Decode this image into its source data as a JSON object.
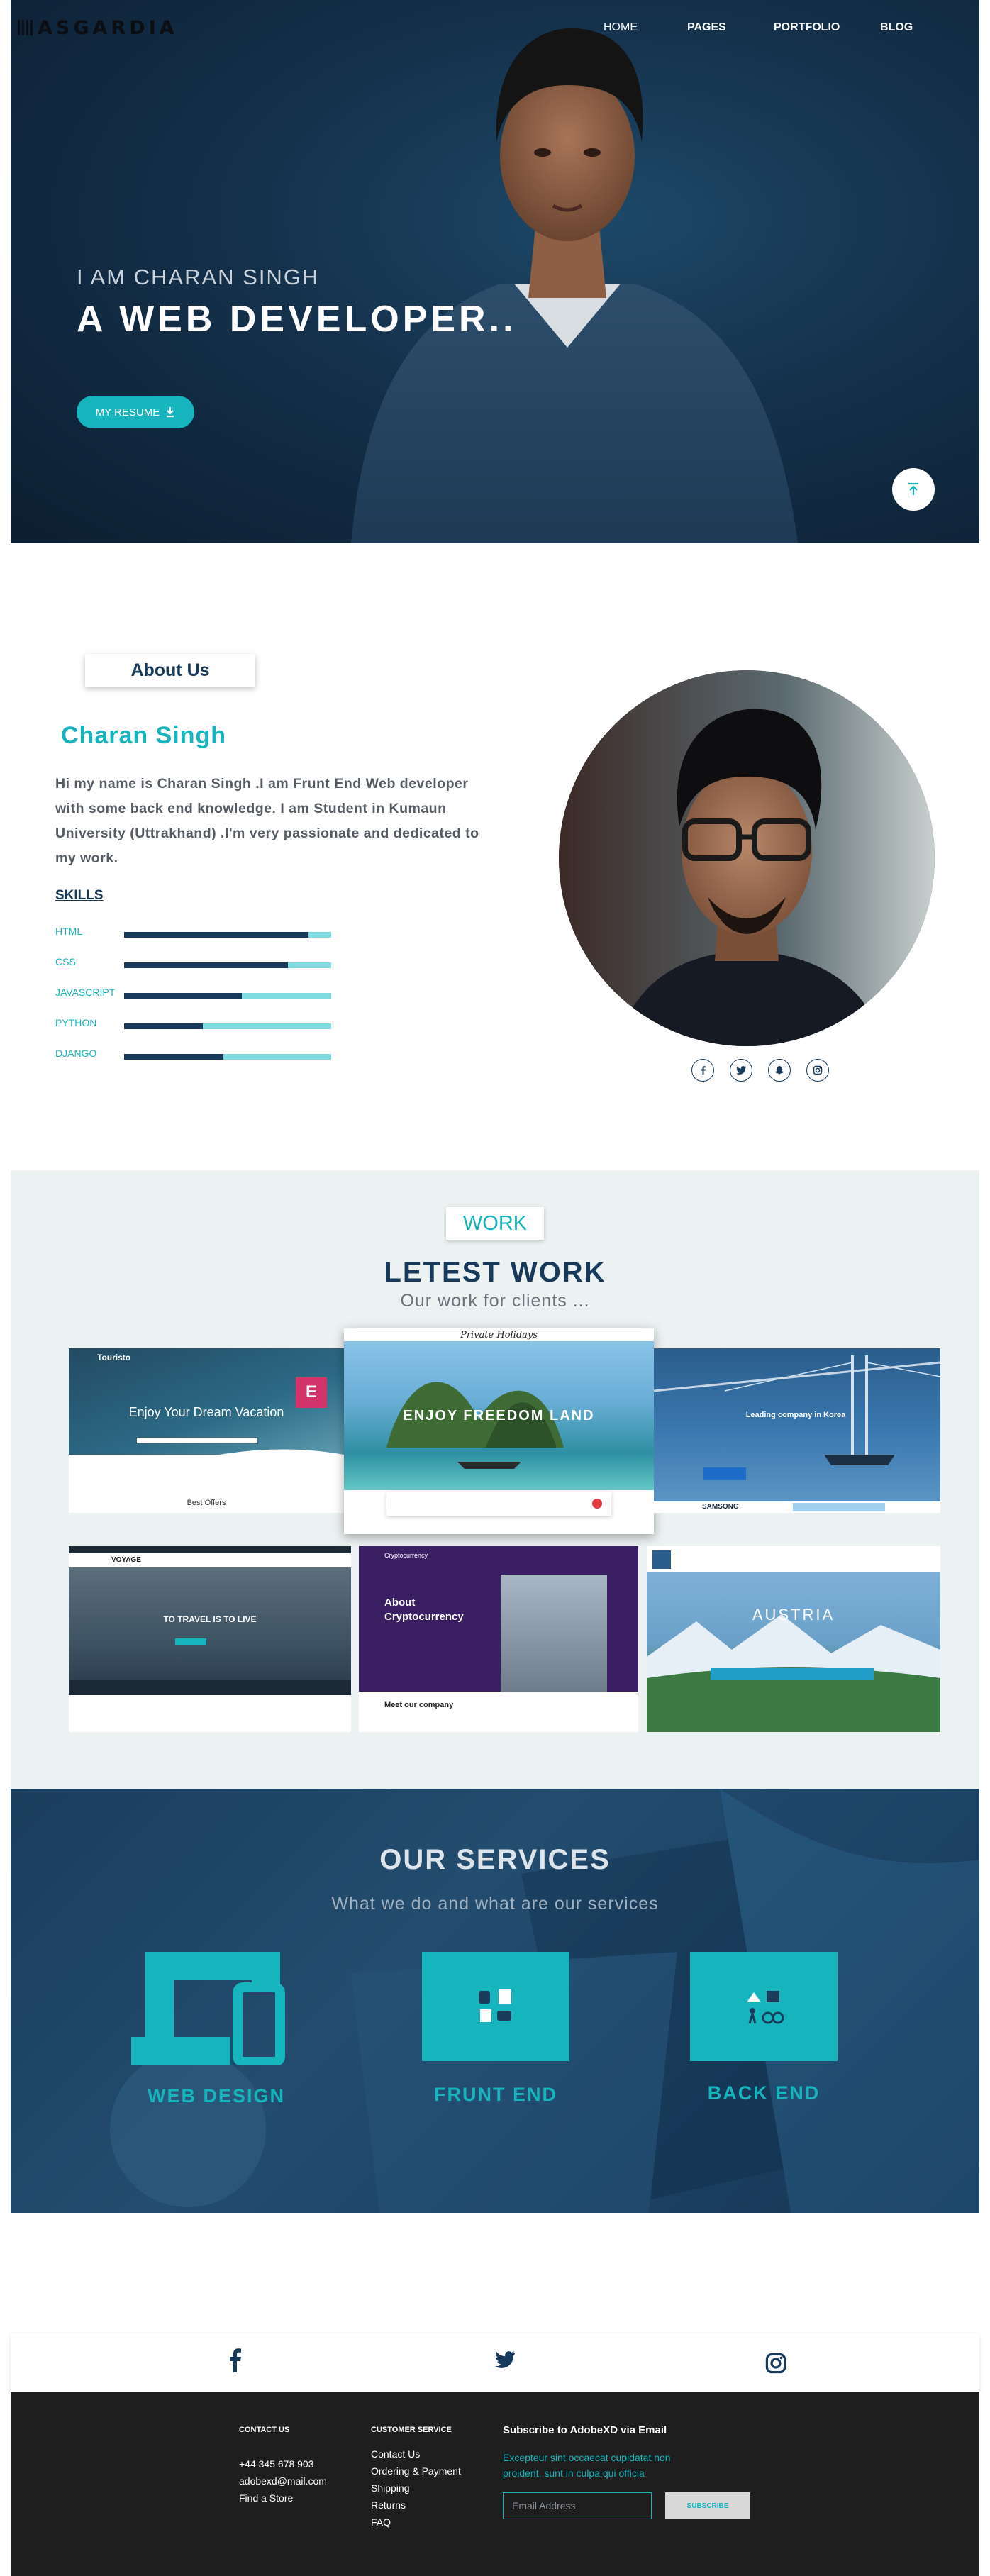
{
  "header": {
    "logo_text": "ASGARDIA",
    "nav": [
      {
        "label": "HOME"
      },
      {
        "label": "PAGES"
      },
      {
        "label": "PORTFOLIO"
      },
      {
        "label": "BLOG"
      }
    ]
  },
  "hero": {
    "subtitle": "I AM CHARAN SINGH",
    "title": "A WEB DEVELOPER..",
    "resume_button": "MY RESUME",
    "icons": {
      "download": "download-icon",
      "scroll_up": "arrow-up-icon"
    }
  },
  "about": {
    "label": "About Us",
    "name": "Charan Singh",
    "bio": "Hi my name is Charan Singh .I am Frunt End Web developer with some back end knowledge. I am Student in Kumaun University (Uttrakhand) .I'm very passionate and dedicated to my work.",
    "skills_heading": "SKILLS",
    "skills": [
      {
        "name": "HTML",
        "level": 0.89
      },
      {
        "name": "CSS",
        "level": 0.79
      },
      {
        "name": "JAVASCRIPT",
        "level": 0.57
      },
      {
        "name": "PYTHON",
        "level": 0.38
      },
      {
        "name": "DJANGO",
        "level": 0.48
      }
    ],
    "social_icons": [
      "facebook-icon",
      "twitter-icon",
      "snapchat-icon",
      "instagram-icon"
    ]
  },
  "work": {
    "badge": "WORK",
    "title": "LETEST WORK",
    "subtitle": "Our work for clients ...",
    "projects": [
      {
        "brand": "Touristo",
        "caption": "Enjoy Your Dream Vacation",
        "footer": "Best Offers"
      },
      {
        "brand": "Private Holidays",
        "caption": "ENJOY FREEDOM LAND"
      },
      {
        "brand": "SAMSONG",
        "caption": "Leading company in Korea"
      },
      {
        "brand": "VOYAGE",
        "caption": "TO TRAVEL IS TO LIVE"
      },
      {
        "brand": "Cryptocurrency",
        "caption": "About Cryptocurrency",
        "footer": "Meet our company"
      },
      {
        "brand": "AUSTRIA",
        "caption": "AUSTRIA"
      }
    ]
  },
  "services": {
    "title": "OUR SERVICES",
    "subtitle": "What we do and what are our services",
    "items": [
      {
        "label": "WEB DESIGN",
        "icon": "devices-icon"
      },
      {
        "label": "FRUNT END",
        "icon": "frontend-tools-icon"
      },
      {
        "label": "BACK END",
        "icon": "backend-tools-icon"
      }
    ]
  },
  "social_strip": {
    "icons": [
      "facebook-icon",
      "twitter-icon",
      "instagram-icon"
    ]
  },
  "footer": {
    "contact_heading": "CONTACT US",
    "contact_items": [
      "+44 345 678 903",
      "adobexd@mail.com",
      "Find a Store"
    ],
    "service_heading": "CUSTOMER SERVICE",
    "service_items": [
      "Contact Us",
      "Ordering & Payment",
      "Shipping",
      "Returns",
      "FAQ"
    ],
    "subscribe_heading": "Subscribe to AdobeXD via Email",
    "subscribe_text": "Excepteur sint occaecat cupidatat non proident, sunt in culpa qui officia",
    "email_placeholder": "Email Address",
    "subscribe_button": "SUBSCRIBE"
  },
  "colors": {
    "accent": "#16b4bd",
    "navy": "#17395a",
    "footer_bg": "#1e1e1e"
  }
}
